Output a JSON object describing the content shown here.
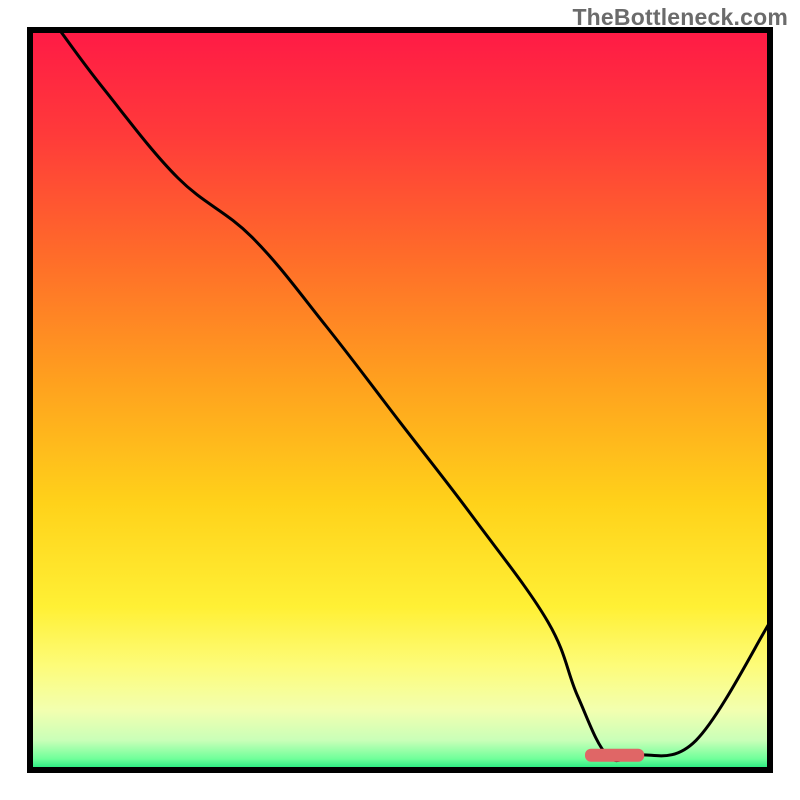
{
  "watermark": "TheBottleneck.com",
  "chart_data": {
    "type": "line",
    "title": "",
    "xlabel": "",
    "ylabel": "",
    "xlim": [
      0,
      100
    ],
    "ylim": [
      0,
      100
    ],
    "x": [
      4,
      10,
      20,
      30,
      40,
      50,
      60,
      70,
      74,
      78,
      82,
      90,
      100
    ],
    "y": [
      100,
      92,
      80,
      72,
      60,
      47,
      34,
      20,
      10,
      2,
      2,
      4,
      20
    ],
    "marker": {
      "x_start": 75,
      "x_end": 83,
      "y": 2
    },
    "gradient_stops": [
      {
        "pos": 0.0,
        "color": "#ff1a46"
      },
      {
        "pos": 0.14,
        "color": "#ff3a3a"
      },
      {
        "pos": 0.3,
        "color": "#ff6a2a"
      },
      {
        "pos": 0.48,
        "color": "#ffa21e"
      },
      {
        "pos": 0.64,
        "color": "#ffd21a"
      },
      {
        "pos": 0.78,
        "color": "#fff035"
      },
      {
        "pos": 0.86,
        "color": "#fdfc7a"
      },
      {
        "pos": 0.92,
        "color": "#f2ffb0"
      },
      {
        "pos": 0.96,
        "color": "#c9ffb8"
      },
      {
        "pos": 0.985,
        "color": "#6fff9a"
      },
      {
        "pos": 1.0,
        "color": "#18e67a"
      }
    ],
    "border_color": "#000000",
    "line_color": "#000000",
    "marker_color": "#e06666"
  }
}
